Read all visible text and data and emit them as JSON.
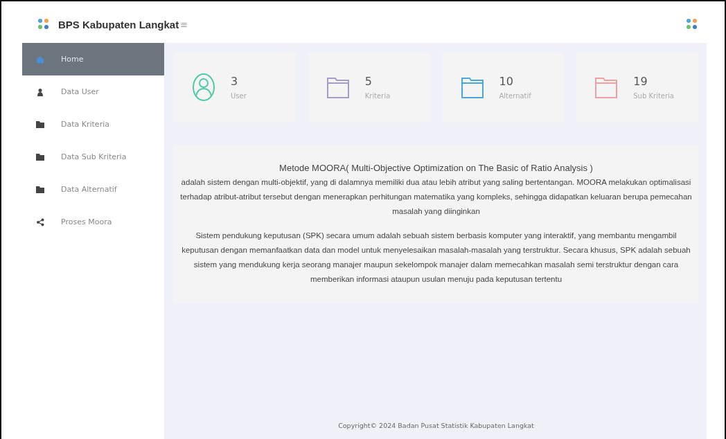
{
  "header": {
    "brand": "BPS Kabupaten Langkat",
    "menu_toggle": "≡"
  },
  "sidebar": {
    "items": [
      {
        "label": "Home",
        "kind": "home",
        "selected": true
      },
      {
        "label": "Data User",
        "kind": "user",
        "selected": false
      },
      {
        "label": "Data Kriteria",
        "kind": "folder",
        "selected": false
      },
      {
        "label": "Data Sub Kriteria",
        "kind": "folder",
        "selected": false
      },
      {
        "label": "Data Alternatif",
        "kind": "folder",
        "selected": false
      },
      {
        "label": "Proses Moora",
        "kind": "share",
        "selected": false
      }
    ]
  },
  "stats": [
    {
      "value": "3",
      "label": "User",
      "kind": "user",
      "color": "#4fc9a8"
    },
    {
      "value": "5",
      "label": "Kriteria",
      "kind": "folder",
      "color": "#a99bc8"
    },
    {
      "value": "10",
      "label": "Alternatif",
      "kind": "folder",
      "color": "#4aa8d8"
    },
    {
      "value": "19",
      "label": "Sub Kriteria",
      "kind": "folder",
      "color": "#f0a0a0"
    }
  ],
  "info": {
    "title": "Metode MOORA( Multi-Objective Optimization on The Basic of Ratio Analysis )",
    "paragraphs": [
      "adalah sistem dengan multi-objektif, yang di dalamnya memiliki dua atau lebih atribut yang saling bertentangan. MOORA melakukan optimalisasi terhadap atribut-atribut tersebut dengan menerapkan perhitungan matematika yang kompleks, sehingga didapatkan keluaran berupa pemecahan masalah yang diinginkan",
      "Sistem pendukung keputusan (SPK) secara umum adalah sebuah sistem berbasis komputer yang interaktif, yang membantu mengambil keputusan dengan memanfaatkan data dan model untuk menyelesaikan masalah-masalah yang terstruktur. Secara khusus, SPK adalah sebuah sistem yang mendukung kerja seorang manajer maupun sekelompok manajer dalam memecahkan masalah semi terstruktur dengan cara memberikan informasi ataupun usulan menuju pada keputusan tertentu"
    ]
  },
  "footer": "Copyright© 2024 Badan Pusat Statistik Kabupaten Langkat"
}
